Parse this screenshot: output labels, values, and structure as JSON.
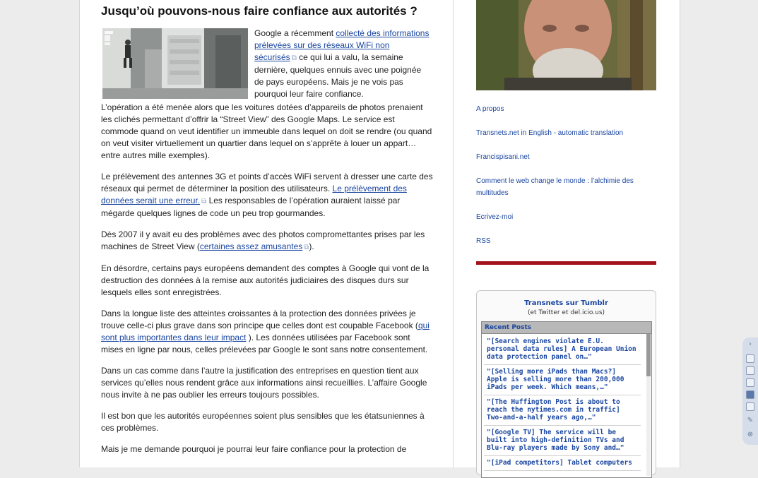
{
  "article": {
    "title": "Jusqu’où pouvons-nous faire confiance aux autorités ?",
    "intro": {
      "pre": "Google a récemment ",
      "link": "collecté des informations prélevées sur des réseaux WiFi non sécurisés",
      "post": " ce qui lui a valu, la semaine dernière, quelques ennuis avec une poignée de pays européens. Mais je ne vois pas pourquoi leur faire confiance."
    },
    "p1": "L’opération a été menée alors que les voitures dotées d’appareils de photos prenaient les clichés permettant d’offrir la “Street View” des Google Maps. Le service est commode quand on veut identifier un immeuble dans lequel on doit se rendre (ou quand on veut visiter virtuellement un quartier dans lequel on s’apprête à louer un appart… entre autres mille exemples).",
    "p2": {
      "pre": "Le prélèvement des antennes 3G et points d’accès WiFi servent à dresser une carte des réseaux qui permet de déterminer la position des utilisateurs. ",
      "link": "Le prélèvement des données serait une erreur.",
      "post": " Les responsables de l’opération auraient laissé par mégarde quelques lignes de code un peu trop gourmandes."
    },
    "p3": {
      "pre": "Dès 2007 il y avait eu des problèmes avec des photos compromettantes prises par les machines de Street View (",
      "link": "certaines assez amusantes",
      "post": ")."
    },
    "p4": "En désordre, certains pays européens demandent des comptes à Google qui vont de la destruction des données à la remise aux autorités judiciaires des disques durs sur lesquels elles sont enregistrées.",
    "p5": {
      "pre": "Dans la longue liste des atteintes croissantes à la protection des données privées je trouve celle-ci plus grave dans son principe que celles dont est coupable Facebook (",
      "link": "qui sont plus importantes dans leur impact",
      "post": " ). Les données utilisées par Facebook sont mises en ligne par nous, celles prélevées par Google le sont sans notre consentement."
    },
    "p6": "Dans un cas comme dans l’autre la justification des entreprises en question tient aux services qu’elles nous rendent grâce aux informations ainsi recueillies. L’affaire Google nous invite à ne pas oublier les erreurs toujours possibles.",
    "p7": "Il est bon que les autorités européennes soient plus sensibles que les étatsuniennes à ces problèmes.",
    "p8": "Mais je me demande pourquoi je pourrai leur faire confiance pour la protection de"
  },
  "sidebar": {
    "links": [
      "A propos",
      "Transnets.net in English - automatic translation",
      "Francispisani.net",
      "Comment le web change le monde : l’alchimie des multitudes",
      "Ecrivez-moi",
      "RSS"
    ],
    "tumblr": {
      "title": "Transnets sur Tumblr",
      "subtitle": "(et Twitter et del.icio.us)",
      "header": "Recent Posts",
      "posts": [
        "\"[Search engines violate E.U. personal data rules] A European Union data protection panel on…\"",
        "\"[Selling more iPads than Macs?] Apple is selling more than 200,000 iPads per week. Which means,…\"",
        "\"[The Huffington Post is about to reach the nytimes.com in traffic] Two-and-a-half years ago,…\"",
        "\"[Google TV] The service will be built into high-definition TVs and Blu-ray players made by Sony and…\"",
        "\"[iPad competitors] Tablet computers"
      ]
    }
  },
  "colors": {
    "link": "#1a46a0",
    "accent_bar": "#a3131c"
  }
}
